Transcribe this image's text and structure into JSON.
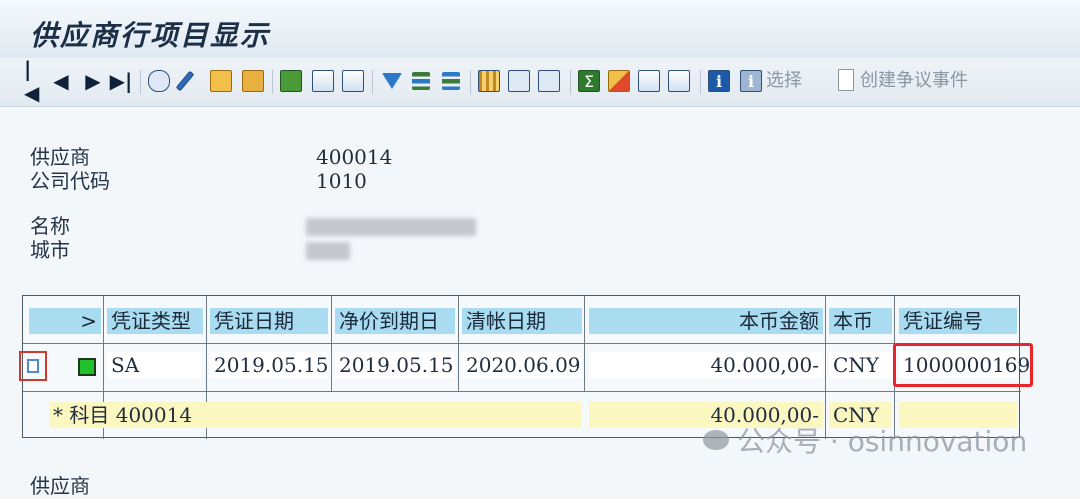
{
  "window": {
    "title": "供应商行项目显示"
  },
  "toolbar": {
    "nav_icons": [
      "first-page-icon",
      "previous-page-icon",
      "next-page-icon",
      "last-page-icon"
    ],
    "select_label": "选择",
    "create_dispute_label": "创建争议事件"
  },
  "header": {
    "vendor_label": "供应商",
    "vendor_value": "400014",
    "company_code_label": "公司代码",
    "company_code_value": "1010",
    "name_label": "名称",
    "city_label": "城市"
  },
  "grid": {
    "columns": {
      "expand": ">",
      "doc_type": "凭证类型",
      "doc_date": "凭证日期",
      "net_due_date": "净价到期日",
      "clearing_date": "清帐日期",
      "local_amount": "本币金额",
      "local_currency": "本币",
      "doc_number": "凭证编号"
    },
    "row": {
      "doc_type": "SA",
      "doc_date": "2019.05.15",
      "net_due_date": "2019.05.15",
      "clearing_date": "2020.06.09",
      "local_amount": "40.000,00-",
      "local_currency": "CNY",
      "doc_number": "1000000169"
    },
    "total": {
      "label": "* 科目 400014",
      "amount": "40.000,00-",
      "currency": "CNY"
    }
  },
  "footer": {
    "next_vendor_label": "供应商"
  },
  "watermark": {
    "text": "公众号 · osinnovation"
  },
  "colors": {
    "header_cell": "#a9dcf0",
    "total_row": "#fbf7c0",
    "highlight_border": "#e8262a",
    "status_green": "#22c02a"
  }
}
